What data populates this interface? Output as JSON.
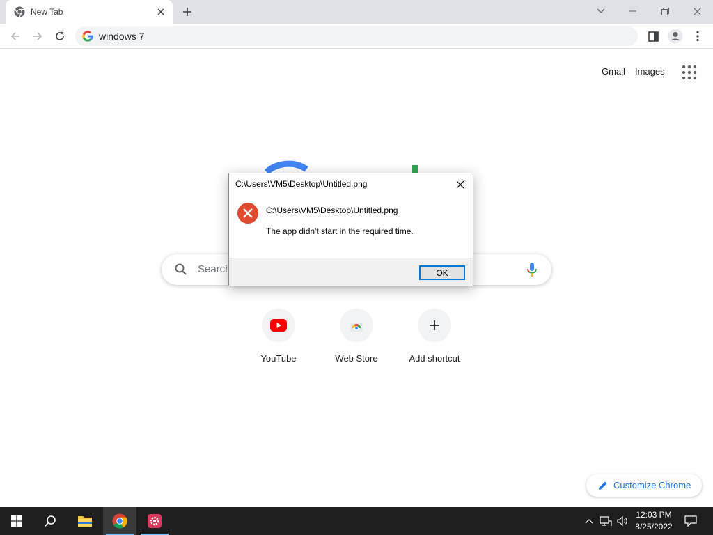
{
  "browser": {
    "tab": {
      "title": "New Tab",
      "favicon": "chrome-icon"
    },
    "omnibox": {
      "value": "windows 7",
      "icon": "google-g-icon"
    }
  },
  "ntp": {
    "links": {
      "gmail": "Gmail",
      "images": "Images"
    },
    "search": {
      "placeholder": "Search"
    },
    "shortcuts": [
      {
        "label": "YouTube",
        "icon": "youtube-icon"
      },
      {
        "label": "Web Store",
        "icon": "web-store-icon"
      },
      {
        "label": "Add shortcut",
        "icon": "plus-icon"
      }
    ],
    "customize_label": "Customize Chrome"
  },
  "dialog": {
    "title": "C:\\Users\\VM5\\Desktop\\Untitled.png",
    "path": "C:\\Users\\VM5\\Desktop\\Untitled.png",
    "message": "The app didn't start in the required time.",
    "ok_label": "OK",
    "icon": "error-icon"
  },
  "taskbar": {
    "time": "12:03 PM",
    "date": "8/25/2022"
  },
  "colors": {
    "tabstrip": "#dee1e6",
    "accent_blue": "#1a73e8",
    "error_red": "#e81123",
    "taskbar": "#1e1e1e"
  }
}
